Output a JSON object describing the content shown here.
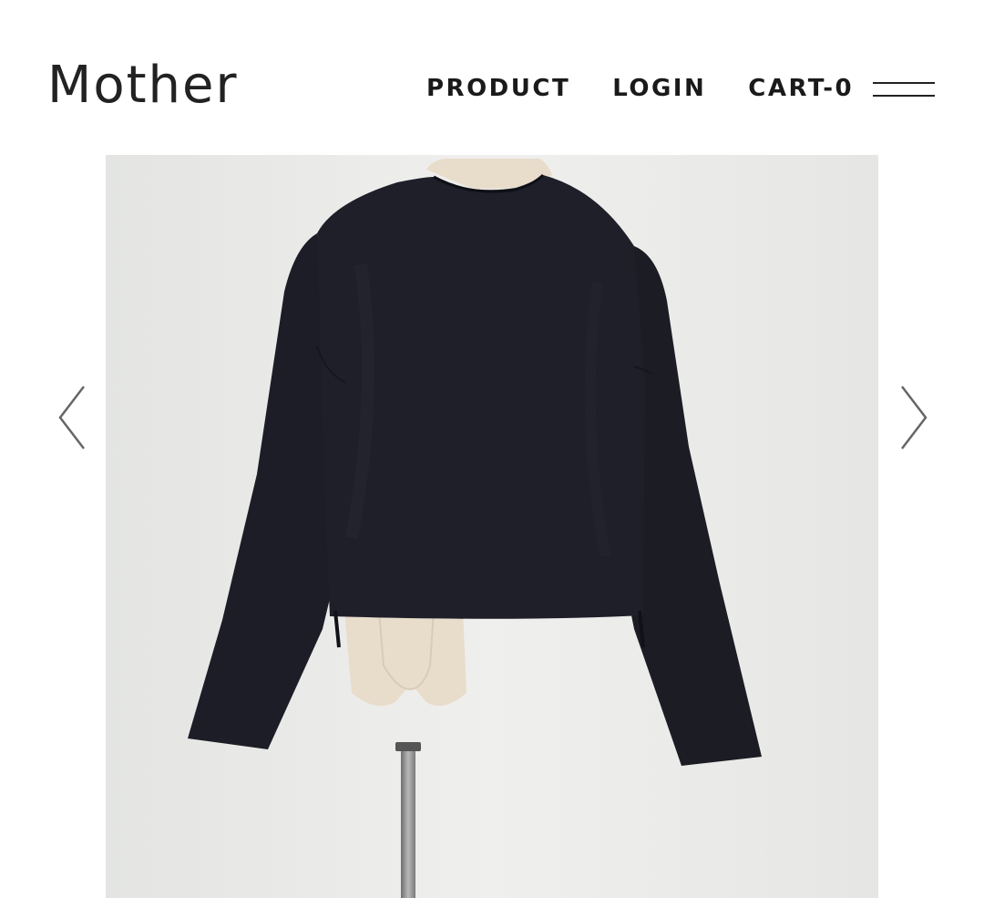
{
  "header": {
    "logo": "Mother",
    "nav": {
      "product": "PRODUCT",
      "login": "LOGIN",
      "cart": "CART-0"
    },
    "menu_icon": "hamburger-menu-icon"
  },
  "carousel": {
    "prev_icon": "chevron-left-icon",
    "next_icon": "chevron-right-icon",
    "image": {
      "subject": "black long-sleeve top on dress form",
      "colors": {
        "background": "#e9e9e7",
        "garment": "#1c1d26",
        "mannequin": "#e8dccb",
        "stand": "#8a8a8a"
      }
    }
  }
}
